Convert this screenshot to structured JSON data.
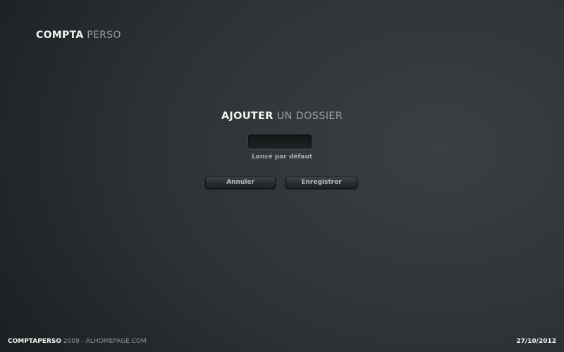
{
  "brand": {
    "bold": "COMPTA",
    "light": "PERSO"
  },
  "dialog": {
    "title_bold": "AJOUTER",
    "title_light": "UN DOSSIER",
    "input_value": "",
    "default_label": "Lancé par défaut",
    "cancel_label": "Annuler",
    "save_label": "Enregistrer"
  },
  "footer": {
    "app_name": "COMPTAPERSO",
    "credits": "2009 - ALHOMEPAGE.COM",
    "date": "27/10/2012"
  }
}
